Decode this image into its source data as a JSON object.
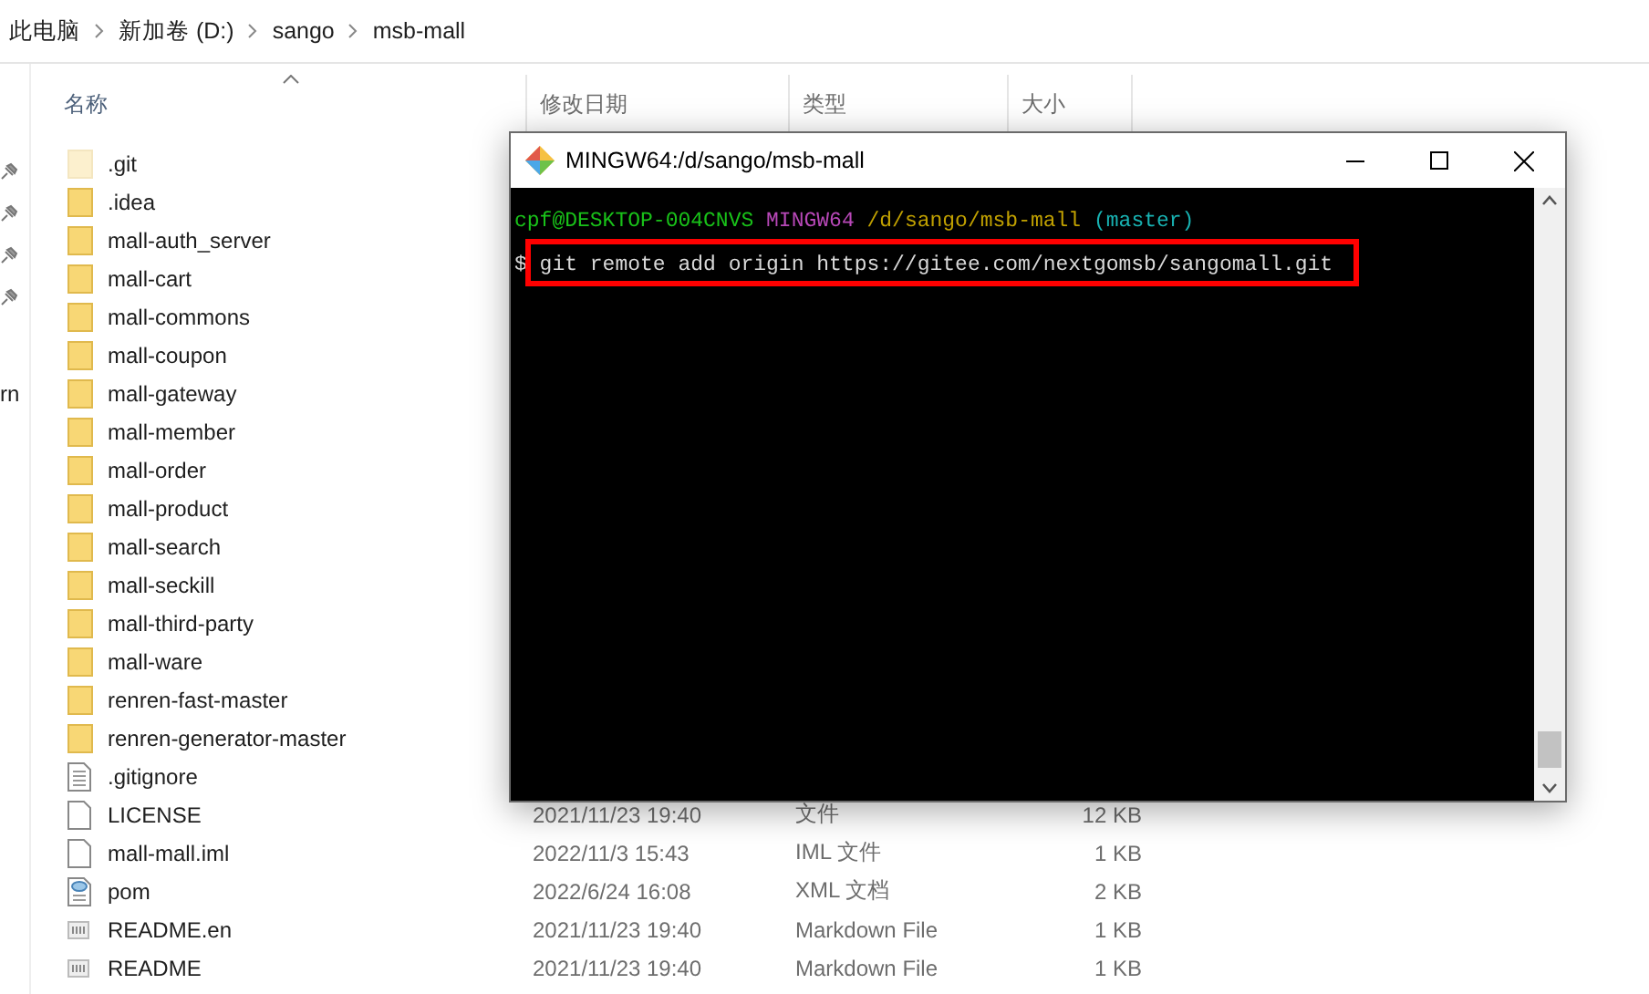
{
  "breadcrumb": [
    "此电脑",
    "新加卷 (D:)",
    "sango",
    "msb-mall"
  ],
  "nav_pane": {
    "pinned_count_text": "rn"
  },
  "columns": [
    {
      "label": "名称",
      "sorted": true
    },
    {
      "label": "修改日期",
      "sorted": false
    },
    {
      "label": "类型",
      "sorted": false
    },
    {
      "label": "大小",
      "sorted": false
    }
  ],
  "files": [
    {
      "name": ".git",
      "kind": "folder",
      "hidden": true
    },
    {
      "name": ".idea",
      "kind": "folder",
      "hidden": false
    },
    {
      "name": "mall-auth_server",
      "kind": "folder",
      "hidden": false
    },
    {
      "name": "mall-cart",
      "kind": "folder",
      "hidden": false
    },
    {
      "name": "mall-commons",
      "kind": "folder",
      "hidden": false
    },
    {
      "name": "mall-coupon",
      "kind": "folder",
      "hidden": false
    },
    {
      "name": "mall-gateway",
      "kind": "folder",
      "hidden": false
    },
    {
      "name": "mall-member",
      "kind": "folder",
      "hidden": false
    },
    {
      "name": "mall-order",
      "kind": "folder",
      "hidden": false
    },
    {
      "name": "mall-product",
      "kind": "folder",
      "hidden": false
    },
    {
      "name": "mall-search",
      "kind": "folder",
      "hidden": false
    },
    {
      "name": "mall-seckill",
      "kind": "folder",
      "hidden": false
    },
    {
      "name": "mall-third-party",
      "kind": "folder",
      "hidden": false
    },
    {
      "name": "mall-ware",
      "kind": "folder",
      "hidden": false
    },
    {
      "name": "renren-fast-master",
      "kind": "folder",
      "hidden": false
    },
    {
      "name": "renren-generator-master",
      "kind": "folder",
      "hidden": false
    },
    {
      "name": ".gitignore",
      "kind": "text",
      "hidden": false
    },
    {
      "name": "LICENSE",
      "kind": "blank",
      "hidden": false,
      "date": "2021/11/23 19:40",
      "type": "文件",
      "size": "12 KB"
    },
    {
      "name": "mall-mall.iml",
      "kind": "blank",
      "hidden": false,
      "date": "2022/11/3 15:43",
      "type": "IML 文件",
      "size": "1 KB"
    },
    {
      "name": "pom",
      "kind": "xml",
      "hidden": false,
      "date": "2022/6/24 16:08",
      "type": "XML 文档",
      "size": "2 KB"
    },
    {
      "name": "README.en",
      "kind": "markdown",
      "hidden": false,
      "date": "2021/11/23 19:40",
      "type": "Markdown File",
      "size": "1 KB"
    },
    {
      "name": "README",
      "kind": "markdown",
      "hidden": false,
      "date": "2021/11/23 19:40",
      "type": "Markdown File",
      "size": "1 KB"
    }
  ],
  "terminal": {
    "title": "MINGW64:/d/sango/msb-mall",
    "prompt": [
      {
        "text": "cpf@DESKTOP-004CNVS",
        "kind": "user"
      },
      {
        "text": "MINGW64",
        "kind": "shell"
      },
      {
        "text": "/d/sango/msb-mall",
        "kind": "path"
      },
      {
        "text": "(master)",
        "kind": "branch"
      }
    ],
    "command": {
      "symbol": "$",
      "text": "git remote add origin https://gitee.com/nextgomsb/sangomall.git",
      "highlighted": true
    }
  }
}
